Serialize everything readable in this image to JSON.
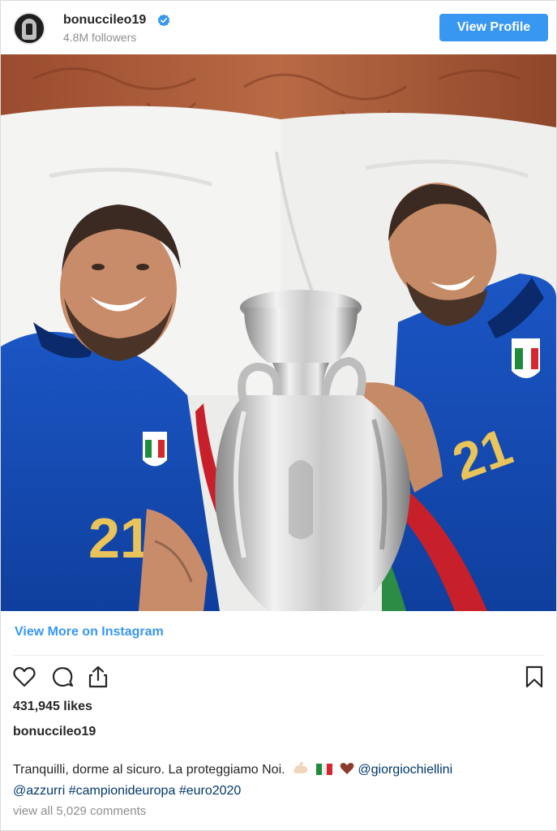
{
  "header": {
    "username": "bonuccileo19",
    "followers": "4.8M followers",
    "view_profile_label": "View Profile"
  },
  "post": {
    "view_more_label": "View More on Instagram",
    "likes": "431,945 likes",
    "caption_user": "bonuccileo19",
    "caption_text": "Tranquilli, dorme al sicuro. La proteggiamo Noi.",
    "mentions": [
      "@giorgiochiellini",
      "@azzurri"
    ],
    "hashtags": [
      "#campionideuropa",
      "#euro2020"
    ],
    "comments_label": "view all 5,029 comments"
  },
  "icons": [
    "heart-icon",
    "comment-icon",
    "share-icon",
    "bookmark-icon",
    "verified-icon"
  ],
  "colors": {
    "accent": "#3897f0",
    "link": "#00376b",
    "muted": "#8e8e8e"
  }
}
